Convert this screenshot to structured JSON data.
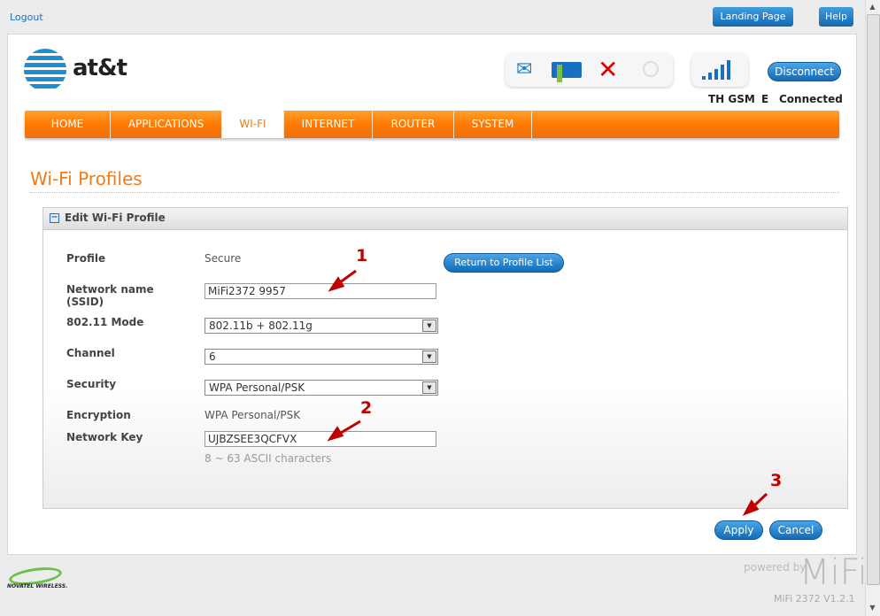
{
  "top": {
    "logout": "Logout",
    "landing_page": "Landing Page",
    "help": "Help"
  },
  "brand": {
    "logo_text": "at&t"
  },
  "status": {
    "icons": [
      "envelope-icon",
      "battery-charging-icon",
      "wifi-disabled-icon",
      "gps-icon",
      "signal-bars-icon"
    ],
    "network": "TH GSM",
    "tech": "E",
    "connection": "Connected",
    "disconnect": "Disconnect"
  },
  "nav": {
    "tabs": [
      "HOME",
      "APPLICATIONS",
      "WI-FI",
      "INTERNET",
      "ROUTER",
      "SYSTEM"
    ],
    "active": "WI-FI"
  },
  "page_title": "Wi-Fi Profiles",
  "section": {
    "title": "Edit Wi-Fi Profile"
  },
  "form": {
    "profile_label": "Profile",
    "profile_value": "Secure",
    "return_button": "Return to Profile List",
    "ssid_label": "Network name (SSID)",
    "ssid_value": "MiFi2372 9957",
    "mode_label": "802.11 Mode",
    "mode_value": "802.11b + 802.11g",
    "channel_label": "Channel",
    "channel_value": "6",
    "security_label": "Security",
    "security_value": "WPA Personal/PSK",
    "encryption_label": "Encryption",
    "encryption_value": "WPA Personal/PSK",
    "key_label": "Network Key",
    "key_value": "UJBZSEE3QCFVX",
    "key_hint": "8 ~ 63 ASCII characters"
  },
  "annotations": [
    "1",
    "2",
    "3"
  ],
  "actions": {
    "apply": "Apply",
    "cancel": "Cancel"
  },
  "footer": {
    "vendor": "NOVATEL WIRELESS.",
    "powered_by": "powered by",
    "brand": "MiFi",
    "version": "MiFi 2372 V1.2.1"
  },
  "colors": {
    "accent": "#f07c1b",
    "button": "#1a6fc0",
    "annotation": "#c00000"
  }
}
